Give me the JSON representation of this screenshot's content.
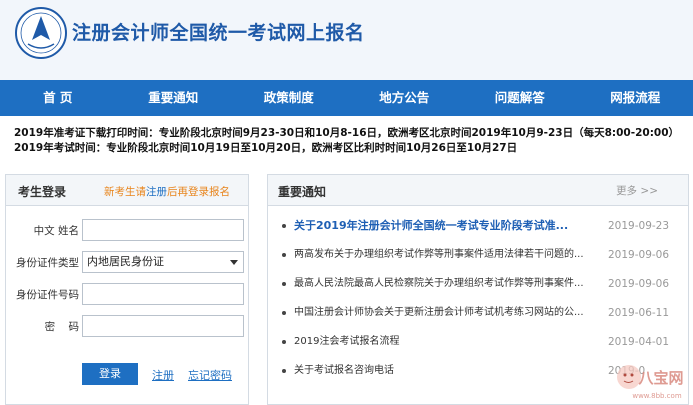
{
  "header": {
    "title": "注册会计师全国统一考试网上报名"
  },
  "nav": {
    "items": [
      "首 页",
      "重要通知",
      "政策制度",
      "地方公告",
      "问题解答",
      "网报流程"
    ]
  },
  "notice": {
    "line1": "2019年准考证下载打印时间：专业阶段北京时间9月23-30日和10月8-16日，欧洲考区北京时间2019年10月9-23日（每天8:00-20:00）",
    "line2": "2019年考试时间：专业阶段北京时间10月19日至10月20日，欧洲考区比利时时间10月26日至10月27日"
  },
  "login": {
    "title": "考生登录",
    "hint_prefix": "新考生请",
    "hint_link": "注册",
    "hint_suffix": "后再登录报名",
    "name_label": "中文 姓名",
    "idtype_label": "身份证件类型",
    "idtype_value": "内地居民身份证",
    "idnum_label": "身份证件号码",
    "password_label": "密    码",
    "login_button": "登录",
    "register_link": "注册",
    "forgot_link": "忘记密码"
  },
  "news": {
    "title": "重要通知",
    "more": "更多 >>",
    "items": [
      {
        "text": "关于2019年注册会计师全国统一考试专业阶段考试准...",
        "date": "2019-09-23",
        "hot": true
      },
      {
        "text": "两高发布关于办理组织考试作弊等刑事案件适用法律若干问题的...",
        "date": "2019-09-06",
        "hot": false
      },
      {
        "text": "最高人民法院最高人民检察院关于办理组织考试作弊等刑事案件...",
        "date": "2019-09-06",
        "hot": false
      },
      {
        "text": "中国注册会计师协会关于更新注册会计师考试机考练习网站的公...",
        "date": "2019-06-11",
        "hot": false
      },
      {
        "text": "2019注会考试报名流程",
        "date": "2019-04-01",
        "hot": false
      },
      {
        "text": "关于考试报名咨询电话",
        "date": "2019-0",
        "hot": false
      }
    ]
  },
  "watermark": {
    "text": "八宝网",
    "url_text": "www.8bb.com"
  },
  "colors": {
    "brand_blue": "#1e6fc2",
    "hint_orange": "#e8841b"
  }
}
